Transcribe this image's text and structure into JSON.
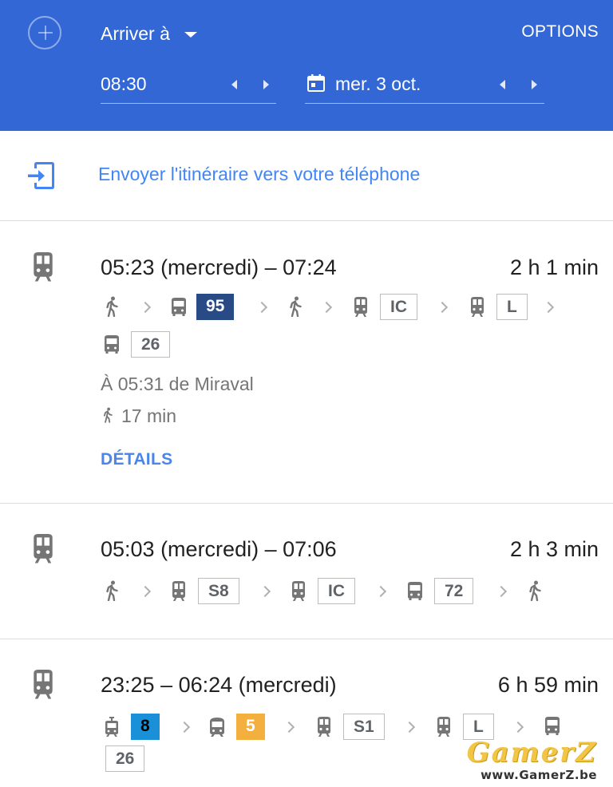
{
  "colors": {
    "header_bg": "#3367d6",
    "link_blue": "#4285f4",
    "badge_navy": "#284b86",
    "badge_blue": "#1a90d8",
    "badge_orange": "#f4b03f",
    "icon_gray": "#757575"
  },
  "header": {
    "add_icon": "plus-circle-icon",
    "mode_label": "Arriver à",
    "options_label": "OPTIONS",
    "time_value": "08:30",
    "date_value": "mer. 3 oct.",
    "date_icon": "calendar-icon"
  },
  "send_to_phone": {
    "icon": "send-to-phone-icon",
    "label": "Envoyer l'itinéraire vers votre téléphone"
  },
  "routes": [
    {
      "icon": "train-icon",
      "times": "05:23 (mercredi) – 07:24",
      "duration": "2 h 1 min",
      "steps": [
        {
          "mode": "walk-icon"
        },
        {
          "mode": "bus-icon",
          "line": "95",
          "style": "filled-navy"
        },
        {
          "mode": "walk-icon"
        },
        {
          "mode": "train-icon",
          "line": "IC",
          "style": "outline"
        },
        {
          "mode": "train-icon",
          "line": "L",
          "style": "outline"
        },
        {
          "mode": "bus-icon",
          "line": "26",
          "style": "outline"
        }
      ],
      "departure": "À 05:31 de Miraval",
      "walk_time": "17 min",
      "details_label": "DÉTAILS"
    },
    {
      "icon": "train-icon",
      "times": "05:03 (mercredi) – 07:06",
      "duration": "2 h 3 min",
      "steps": [
        {
          "mode": "walk-icon"
        },
        {
          "mode": "train-icon",
          "line": "S8",
          "style": "outline"
        },
        {
          "mode": "train-icon",
          "line": "IC",
          "style": "outline"
        },
        {
          "mode": "bus-icon",
          "line": "72",
          "style": "outline"
        },
        {
          "mode": "walk-icon"
        }
      ]
    },
    {
      "icon": "train-icon",
      "times": "23:25 – 06:24 (mercredi)",
      "duration": "6 h 59 min",
      "steps": [
        {
          "mode": "tram-icon",
          "line": "8",
          "style": "filled-blue"
        },
        {
          "mode": "subway-icon",
          "line": "5",
          "style": "filled-orange"
        },
        {
          "mode": "train-icon",
          "line": "S1",
          "style": "outline"
        },
        {
          "mode": "train-icon",
          "line": "L",
          "style": "outline"
        },
        {
          "mode": "bus-icon",
          "line": "26",
          "style": "outline"
        }
      ]
    }
  ],
  "watermark": {
    "logo": "GamerZ",
    "url": "www.GamerZ.be"
  }
}
